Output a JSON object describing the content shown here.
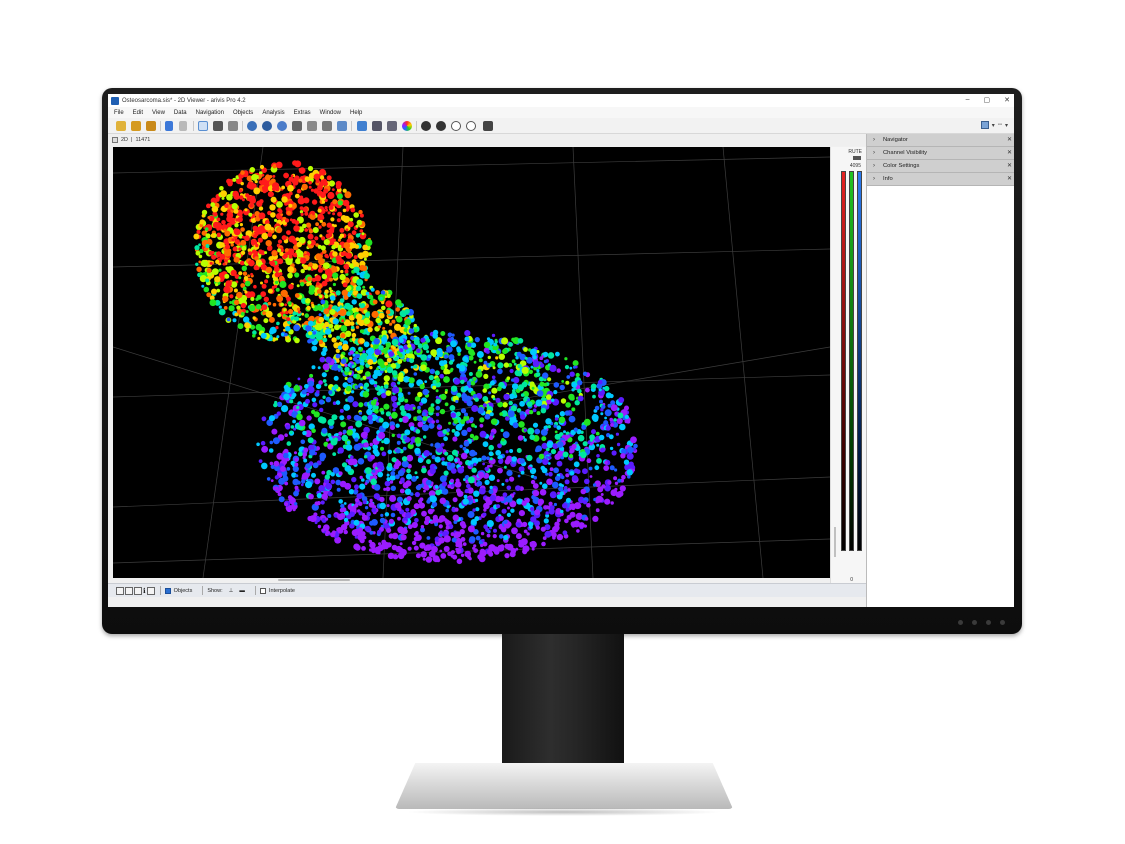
{
  "window": {
    "title": "Osteosarcoma.sis* - 2D Viewer - arivis Pro 4.2",
    "controls": {
      "minimize": "–",
      "maximize": "▢",
      "close": "✕"
    }
  },
  "menu": [
    "File",
    "Edit",
    "View",
    "Data",
    "Navigation",
    "Objects",
    "Analysis",
    "Extras",
    "Window",
    "Help"
  ],
  "toolbar_icons": [
    "open-file-icon",
    "save-icon",
    "save-as-icon",
    "undo-icon",
    "redo-icon",
    "pointer-icon",
    "zoom-icon",
    "pan-hand-icon",
    "rotate-icon",
    "sphere-icon",
    "brush-icon",
    "magic-wand-icon",
    "pen-icon",
    "lasso-icon",
    "object-tool-icon",
    "flask-icon",
    "table-icon",
    "chart-icon",
    "color-icon",
    "zoom-in-icon",
    "zoom-out-icon",
    "fit-icon",
    "center-icon",
    "snapshot-icon"
  ],
  "view_tab": {
    "label": "2D",
    "frame": "11471"
  },
  "lut": {
    "label": "RUTE",
    "max": "4095",
    "min": "0",
    "colors": [
      "#e52222",
      "#22c422",
      "#2b7bf0"
    ]
  },
  "panels": [
    {
      "name": "Navigator"
    },
    {
      "name": "Channel Visibility"
    },
    {
      "name": "Color Settings"
    },
    {
      "name": "Info"
    }
  ],
  "bottombar": {
    "objects_label": "Objects",
    "objects_checked": true,
    "show_label": "Show:",
    "interpolate_label": "Interpolate",
    "interpolate_checked": false
  },
  "colors": {
    "palette": [
      "#ff1a1a",
      "#ff6a00",
      "#ffd000",
      "#b8ff00",
      "#22e622",
      "#00e6a0",
      "#00c8ff",
      "#1e5bff",
      "#5a1cff",
      "#9b1cff"
    ],
    "viewport_bg": "#000000"
  }
}
